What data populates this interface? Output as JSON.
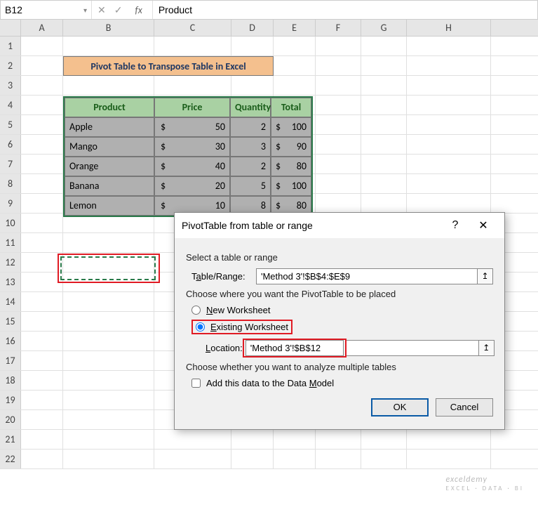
{
  "namebox": {
    "value": "B12"
  },
  "formula_bar": {
    "value": "Product",
    "fx_label": "fx"
  },
  "columns": [
    "A",
    "B",
    "C",
    "D",
    "E",
    "F",
    "G",
    "H"
  ],
  "row_count": 22,
  "title": "Pivot Table to Transpose Table in Excel",
  "table": {
    "headers": [
      "Product",
      "Price",
      "Quantity",
      "Total"
    ],
    "rows": [
      {
        "product": "Apple",
        "price": "50",
        "qty": "2",
        "total": "100"
      },
      {
        "product": "Mango",
        "price": "30",
        "qty": "3",
        "total": "90"
      },
      {
        "product": "Orange",
        "price": "40",
        "qty": "2",
        "total": "80"
      },
      {
        "product": "Banana",
        "price": "20",
        "qty": "5",
        "total": "100"
      },
      {
        "product": "Lemon",
        "price": "10",
        "qty": "8",
        "total": "80"
      }
    ],
    "currency": "$"
  },
  "dialog": {
    "title": "PivotTable from table or range",
    "help": "?",
    "close": "✕",
    "select_label": "Select a table or range",
    "table_range_label_pre": "T",
    "table_range_label_u": "a",
    "table_range_label_post": "ble/Range:",
    "table_range_value": "'Method 3'!$B$4:$E$9",
    "choose_label": "Choose where you want the PivotTable to be placed",
    "new_ws_u": "N",
    "new_ws_post": "ew Worksheet",
    "existing_u": "E",
    "existing_post": "xisting Worksheet",
    "location_u": "L",
    "location_post": "ocation:",
    "location_value": "'Method 3'!$B$12",
    "multi_label": "Choose whether you want to analyze multiple tables",
    "datamodel_pre": "Add this data to the Data ",
    "datamodel_u": "M",
    "datamodel_post": "odel",
    "ok": "OK",
    "cancel": "Cancel",
    "collapse_icon": "↥"
  },
  "watermark": {
    "main": "exceldemy",
    "sub": "EXCEL · DATA · BI"
  },
  "chart_data": {
    "type": "table",
    "title": "Pivot Table to Transpose Table in Excel",
    "headers": [
      "Product",
      "Price",
      "Quantity",
      "Total"
    ],
    "rows": [
      [
        "Apple",
        50,
        2,
        100
      ],
      [
        "Mango",
        30,
        3,
        90
      ],
      [
        "Orange",
        40,
        2,
        80
      ],
      [
        "Banana",
        20,
        5,
        100
      ],
      [
        "Lemon",
        10,
        8,
        80
      ]
    ]
  }
}
